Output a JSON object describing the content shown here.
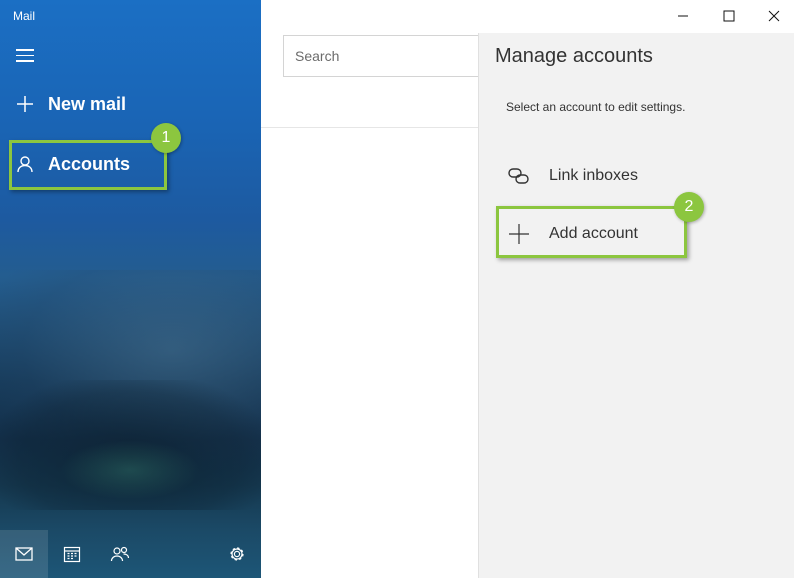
{
  "app": {
    "title": "Mail"
  },
  "sidebar": {
    "new_mail_label": "New mail",
    "accounts_label": "Accounts",
    "bottom_icons": [
      "mail-icon",
      "calendar-icon",
      "people-icon",
      "settings-icon"
    ]
  },
  "middle": {
    "search_placeholder": "Search"
  },
  "manage_accounts": {
    "title": "Manage accounts",
    "subtitle": "Select an account to edit settings.",
    "link_inboxes_label": "Link inboxes",
    "add_account_label": "Add account"
  },
  "callouts": {
    "first": "1",
    "second": "2"
  },
  "colors": {
    "accent": "#8cc63f",
    "sidebar_blue": "#1b6fc4",
    "pane_gray": "#f2f2f2"
  },
  "window_controls": [
    "minimize-icon",
    "maximize-icon",
    "close-icon"
  ]
}
